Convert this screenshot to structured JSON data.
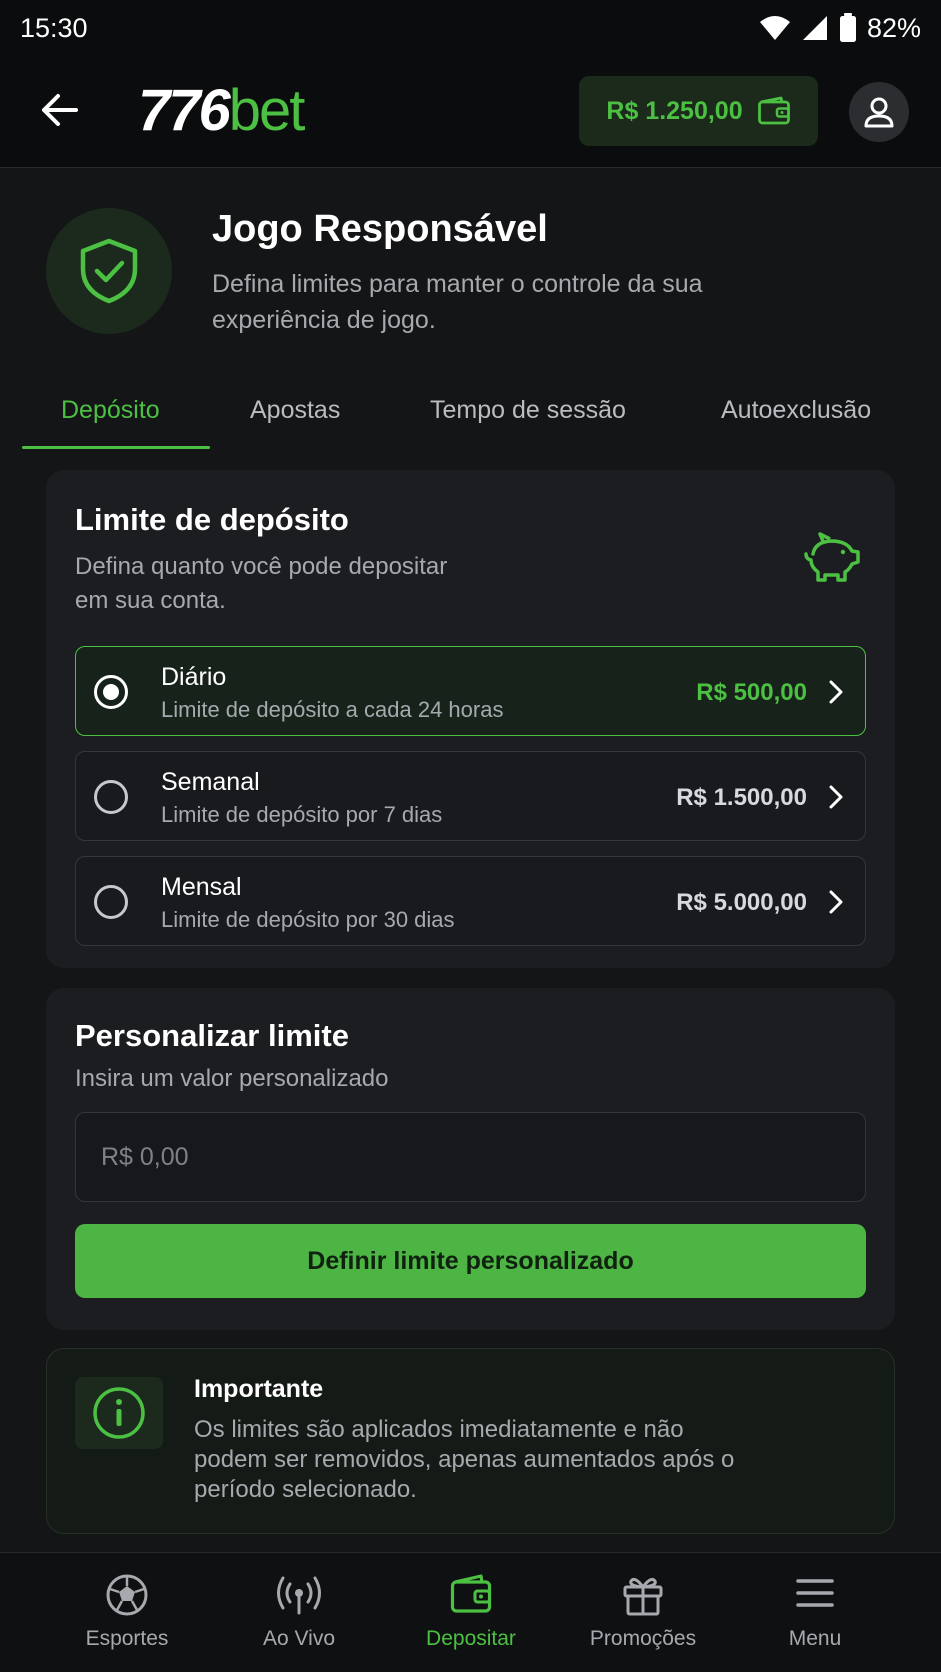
{
  "status_bar": {
    "time": "15:30",
    "battery": "82%"
  },
  "header": {
    "logo_number": "776",
    "logo_suffix": "bet",
    "balance": "R$ 1.250,00"
  },
  "intro": {
    "title": "Jogo Responsável",
    "description": "Defina limites para manter o controle da sua experiência de jogo."
  },
  "tabs": [
    {
      "label": "Depósito",
      "active": true
    },
    {
      "label": "Apostas",
      "active": false
    },
    {
      "label": "Tempo de sessão",
      "active": false
    },
    {
      "label": "Autoexclusão",
      "active": false
    }
  ],
  "deposit_limit": {
    "title": "Limite de depósito",
    "subtitle_line1": "Defina quanto você pode depositar",
    "subtitle_line2": "em sua conta.",
    "options": [
      {
        "name": "Diário",
        "description": "Limite de depósito a cada 24 horas",
        "amount": "R$ 500,00",
        "selected": true
      },
      {
        "name": "Semanal",
        "description": "Limite de depósito por 7 dias",
        "amount": "R$ 1.500,00",
        "selected": false
      },
      {
        "name": "Mensal",
        "description": "Limite de depósito por 30 dias",
        "amount": "R$ 5.000,00",
        "selected": false
      }
    ]
  },
  "custom_limit": {
    "title": "Personalizar limite",
    "subtitle": "Insira um valor personalizado",
    "placeholder": "R$ 0,00",
    "button_label": "Definir limite personalizado"
  },
  "info": {
    "title": "Importante",
    "text": "Os limites são aplicados imediatamente e não podem ser removidos, apenas aumentados após o período selecionado."
  },
  "bottom_nav": [
    {
      "label": "Esportes",
      "icon": "soccer-ball-icon",
      "active": false
    },
    {
      "label": "Ao Vivo",
      "icon": "live-broadcast-icon",
      "active": false
    },
    {
      "label": "Depositar",
      "icon": "wallet-icon",
      "active": true
    },
    {
      "label": "Promoções",
      "icon": "gift-icon",
      "active": false
    },
    {
      "label": "Menu",
      "icon": "hamburger-menu-icon",
      "active": false
    }
  ],
  "colors": {
    "accent": "#4cc042",
    "background": "#141517",
    "card": "#1c1d20"
  }
}
